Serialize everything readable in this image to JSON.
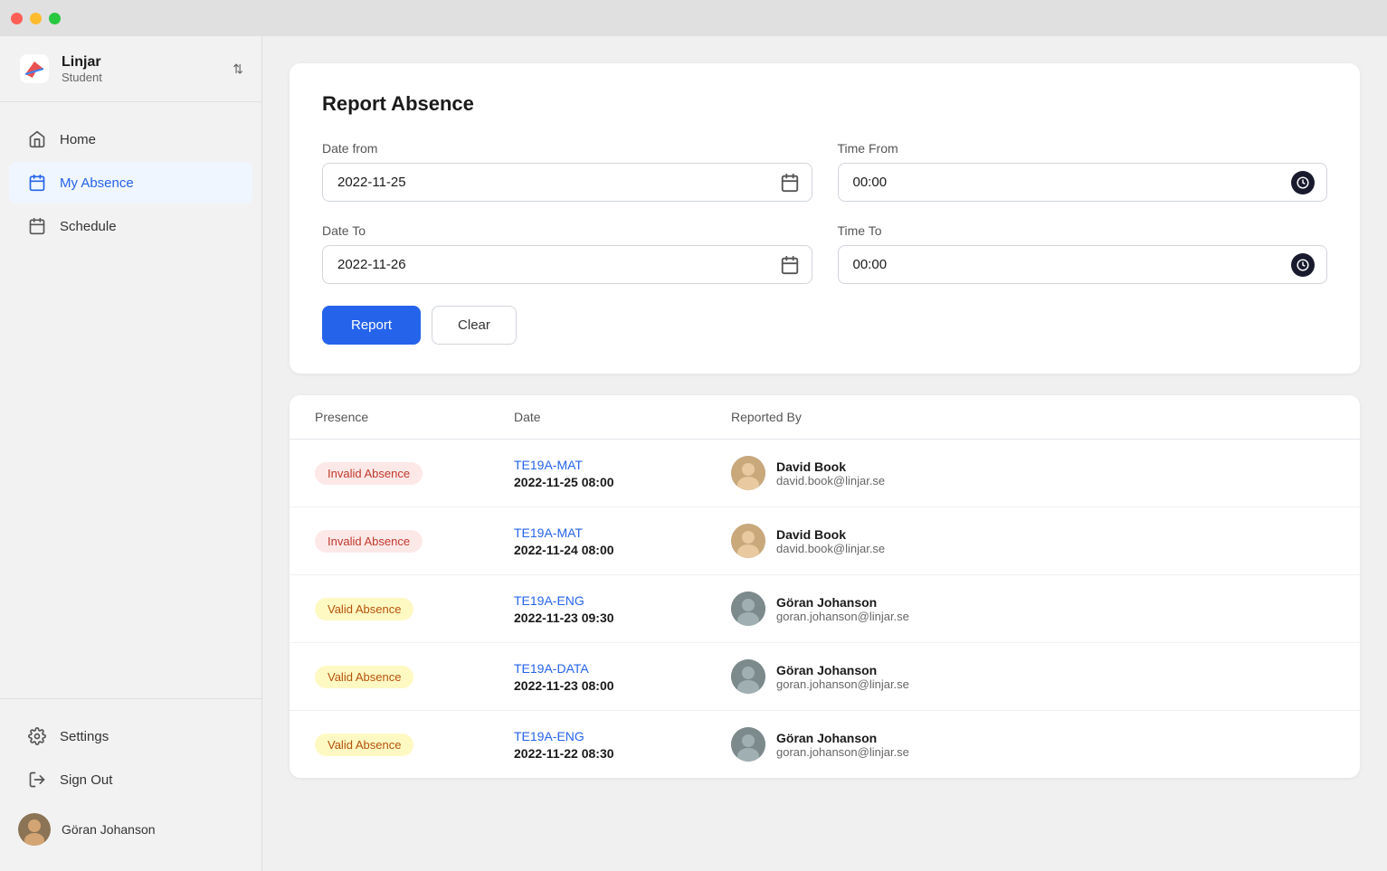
{
  "window": {
    "title": "Linjar"
  },
  "titlebar": {
    "btn_close": "close",
    "btn_min": "minimize",
    "btn_max": "maximize"
  },
  "sidebar": {
    "app_name": "Linjar",
    "role": "Student",
    "chevron": "⌃",
    "nav_items": [
      {
        "id": "home",
        "label": "Home",
        "icon": "home",
        "active": false
      },
      {
        "id": "my-absence",
        "label": "My Absence",
        "icon": "calendar-check",
        "active": true
      },
      {
        "id": "schedule",
        "label": "Schedule",
        "icon": "calendar",
        "active": false
      }
    ],
    "bottom_items": [
      {
        "id": "settings",
        "label": "Settings",
        "icon": "gear"
      },
      {
        "id": "sign-out",
        "label": "Sign Out",
        "icon": "door"
      }
    ],
    "profile": {
      "name": "Göran Johanson",
      "avatar_alt": "Göran Johanson avatar"
    }
  },
  "report_form": {
    "title": "Report Absence",
    "date_from_label": "Date from",
    "date_from_value": "2022-11-25",
    "time_from_label": "Time From",
    "time_from_value": "00:00",
    "date_to_label": "Date To",
    "date_to_value": "2022-11-26",
    "time_to_label": "Time To",
    "time_to_value": "00:00",
    "btn_report": "Report",
    "btn_clear": "Clear"
  },
  "table": {
    "columns": [
      "Presence",
      "Date",
      "Reported By"
    ],
    "rows": [
      {
        "presence_type": "Invalid Absence",
        "presence_class": "badge-invalid",
        "course_code": "TE19A-MAT",
        "date_time": "2022-11-25 08:00",
        "reporter_name": "David Book",
        "reporter_email": "david.book@linjar.se",
        "avatar_style": "light"
      },
      {
        "presence_type": "Invalid Absence",
        "presence_class": "badge-invalid",
        "course_code": "TE19A-MAT",
        "date_time": "2022-11-24 08:00",
        "reporter_name": "David Book",
        "reporter_email": "david.book@linjar.se",
        "avatar_style": "light"
      },
      {
        "presence_type": "Valid Absence",
        "presence_class": "badge-valid",
        "course_code": "TE19A-ENG",
        "date_time": "2022-11-23 09:30",
        "reporter_name": "Göran Johanson",
        "reporter_email": "goran.johanson@linjar.se",
        "avatar_style": "dark"
      },
      {
        "presence_type": "Valid Absence",
        "presence_class": "badge-valid",
        "course_code": "TE19A-DATA",
        "date_time": "2022-11-23 08:00",
        "reporter_name": "Göran Johanson",
        "reporter_email": "goran.johanson@linjar.se",
        "avatar_style": "dark"
      },
      {
        "presence_type": "Valid Absence",
        "presence_class": "badge-valid",
        "course_code": "TE19A-ENG",
        "date_time": "2022-11-22 08:30",
        "reporter_name": "Göran Johanson",
        "reporter_email": "goran.johanson@linjar.se",
        "avatar_style": "dark"
      }
    ]
  }
}
